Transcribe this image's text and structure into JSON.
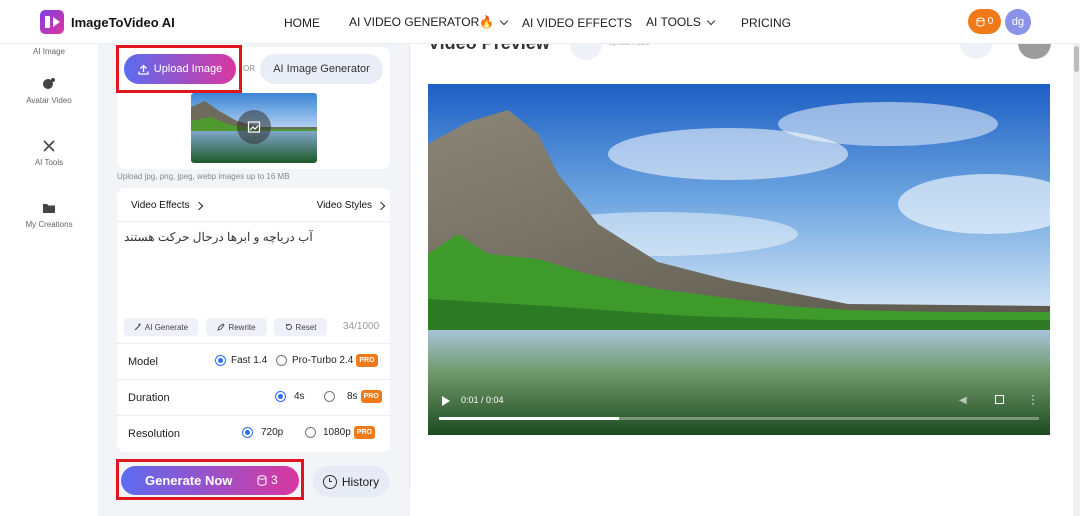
{
  "header": {
    "brand": "ImageToVideo AI",
    "nav": [
      {
        "label": "HOME"
      },
      {
        "label": "AI VIDEO GENERATOR🔥"
      },
      {
        "label": "AI VIDEO EFFECTS"
      },
      {
        "label": "AI TOOLS"
      },
      {
        "label": "PRICING"
      }
    ],
    "credits": "0",
    "avatar_initials": "dg"
  },
  "sidebar": {
    "items": [
      {
        "label": "AI Image"
      },
      {
        "label": "Avatar Video"
      },
      {
        "label": "AI Tools"
      },
      {
        "label": "My Creations"
      }
    ]
  },
  "upload": {
    "upload_label": "Upload Image",
    "or_text": "OR",
    "ai_generator_label": "AI Image Generator",
    "hint": "Upload jpg, png, jpeg, webp images up to 16 MB"
  },
  "prompt": {
    "video_effects_label": "Video Effects",
    "video_styles_label": "Video Styles",
    "text": "آب دریاچه و ابرها درحال حرکت هستند",
    "ai_generate_label": "AI Generate",
    "rewrite_label": "Rewrite",
    "reset_label": "Reset",
    "char_count": "34/1000"
  },
  "settings": {
    "model": {
      "label": "Model",
      "options": [
        {
          "label": "Fast 1.4",
          "selected": true
        },
        {
          "label": "Pro-Turbo 2.4",
          "selected": false,
          "badge": "PRO"
        }
      ]
    },
    "duration": {
      "label": "Duration",
      "options": [
        {
          "label": "4s",
          "selected": true
        },
        {
          "label": "8s",
          "selected": false,
          "badge": "PRO"
        }
      ]
    },
    "resolution": {
      "label": "Resolution",
      "options": [
        {
          "label": "720p",
          "selected": true
        },
        {
          "label": "1080p",
          "selected": false,
          "badge": "PRO"
        }
      ]
    }
  },
  "actions": {
    "generate_label": "Generate Now",
    "generate_credits": "3",
    "history_label": "History"
  },
  "preview": {
    "title": "Video Preview",
    "subtitle": "Upload Audio",
    "time": "0:01 / 0:04",
    "progress": 0.3
  },
  "colors": {
    "accent_gradient_start": "#5b6cf0",
    "accent_gradient_end": "#d9379f",
    "pro_badge": "#f07a1a",
    "highlight": "#e0161f"
  }
}
